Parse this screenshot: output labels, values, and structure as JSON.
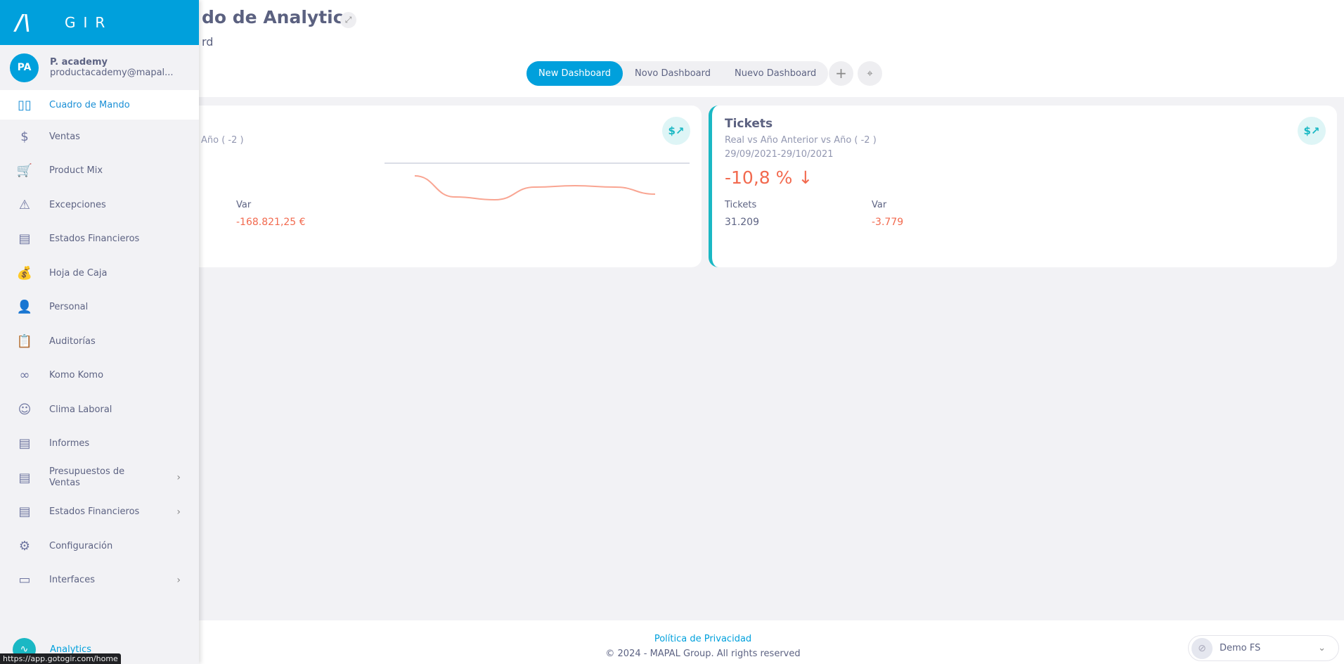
{
  "header": {
    "title_visible": "do de Analytics",
    "subtitle_visible": "rd",
    "expand_icon": "expand-icon"
  },
  "tabs": [
    {
      "label": "New Dashboard",
      "active": true
    },
    {
      "label": "Novo Dashboard"
    },
    {
      "label": "Nuevo Dashboard"
    }
  ],
  "tab_actions": {
    "add_icon": "plus-icon",
    "location_icon": "map-pin-icon"
  },
  "cards": [
    {
      "subtitle_visible": "Año ( -2 )",
      "var_label": "Var",
      "var_value": "-168.821,25 €",
      "icon": "dollar-trend-icon",
      "sparkline": [
        0.95,
        0.2,
        0.1,
        0.55,
        0.6,
        0.55,
        0.3
      ],
      "sparkline_color": "#f9a592"
    },
    {
      "title": "Tickets",
      "subtitle": "Real vs Año Anterior vs Año ( -2 )",
      "date_range": "29/09/2021-29/10/2021",
      "change": "-10,8 %",
      "change_arrow": "↓",
      "metric_label": "Tickets",
      "metric_value": "31.209",
      "var_label": "Var",
      "var_value": "-3.779",
      "icon": "dollar-trend-icon",
      "accent": "#1ab8c4"
    }
  ],
  "sidebar": {
    "brand": "GIR",
    "user": {
      "initials": "PA",
      "name": "P. academy",
      "email": "productacademy@mapal..."
    },
    "items": [
      {
        "label": "Cuadro de Mando",
        "icon": "▯▯",
        "active": true
      },
      {
        "label": "Ventas",
        "icon": "$"
      },
      {
        "label": "Product Mix",
        "icon": "🛒"
      },
      {
        "label": "Excepciones",
        "icon": "⚠"
      },
      {
        "label": "Estados Financieros",
        "icon": "▤"
      },
      {
        "label": "Hoja de Caja",
        "icon": "💰"
      },
      {
        "label": "Personal",
        "icon": "👤"
      },
      {
        "label": "Auditorías",
        "icon": "📋"
      },
      {
        "label": "Komo Komo",
        "icon": "∞"
      },
      {
        "label": "Clima Laboral",
        "icon": "☺"
      },
      {
        "label": "Informes",
        "icon": "▤"
      },
      {
        "label": "Presupuestos de Ventas",
        "icon": "▤",
        "submenu": true
      },
      {
        "label": "Estados Financieros",
        "icon": "▤",
        "submenu": true
      },
      {
        "label": "Configuración",
        "icon": "⚙"
      },
      {
        "label": "Interfaces",
        "icon": "▭",
        "submenu": true
      }
    ],
    "analytics": "Analytics"
  },
  "footer": {
    "policy": "Política de Privacidad",
    "copyright": "© 2024 - MAPAL Group. All rights reserved",
    "org_select": "Demo FS"
  },
  "status_url": "https://app.gotogir.com/home",
  "colors": {
    "brand": "#00a0dc",
    "negative": "#f26a4f",
    "accent": "#1ab8c4"
  }
}
